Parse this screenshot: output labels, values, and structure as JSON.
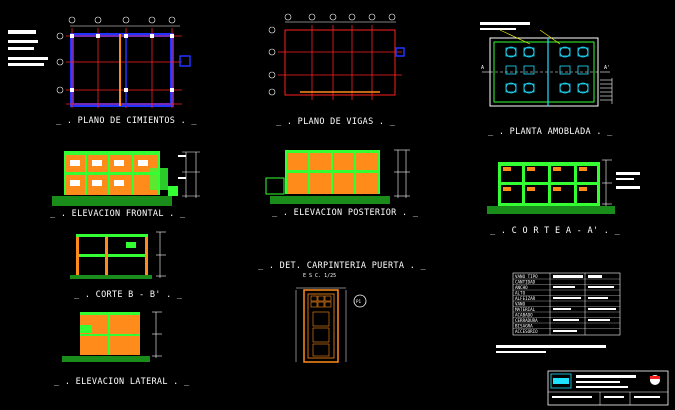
{
  "titles": {
    "plano_cimientos": "_ . PLANO DE CIMIENTOS . _",
    "plano_vigas": "_ . PLANO DE VIGAS . _",
    "planta_amoblada": "_ . PLANTA AMOBLADA . _",
    "elevacion_frontal": "_ . ELEVACION FRONTAL . _",
    "elevacion_posterior": "_ . ELEVACION POSTERIOR . _",
    "corte_aa": "_ . C O R T E A - A' . _",
    "corte_bb": "_ . CORTE B - B' . _",
    "det_carpinteria": "_ . DET. CARPINTERIA PUERTA . _",
    "det_scale": "E S C. 1/25",
    "elevacion_lateral": "_ . ELEVACION LATERAL . _",
    "door_tag": "P1",
    "section_a": "A",
    "section_a2": "A'"
  },
  "legend": {
    "header": "VANO TIPO",
    "rows": [
      "CANTIDAD",
      "ANCHO",
      "ALTO",
      "ALFEIZAR",
      "VANO",
      "MATERIAL",
      "ACABADO",
      "CERRADURA",
      "BISAGRA",
      "ACCESORIO"
    ]
  },
  "colors": {
    "background": "#000000",
    "wall": "#ff8c1a",
    "structure": "#33ff33",
    "axis": "#ff2020",
    "column": "#2233ff",
    "line": "#ffffff",
    "cyan": "#20e0ff",
    "yellow": "#ffff00"
  }
}
